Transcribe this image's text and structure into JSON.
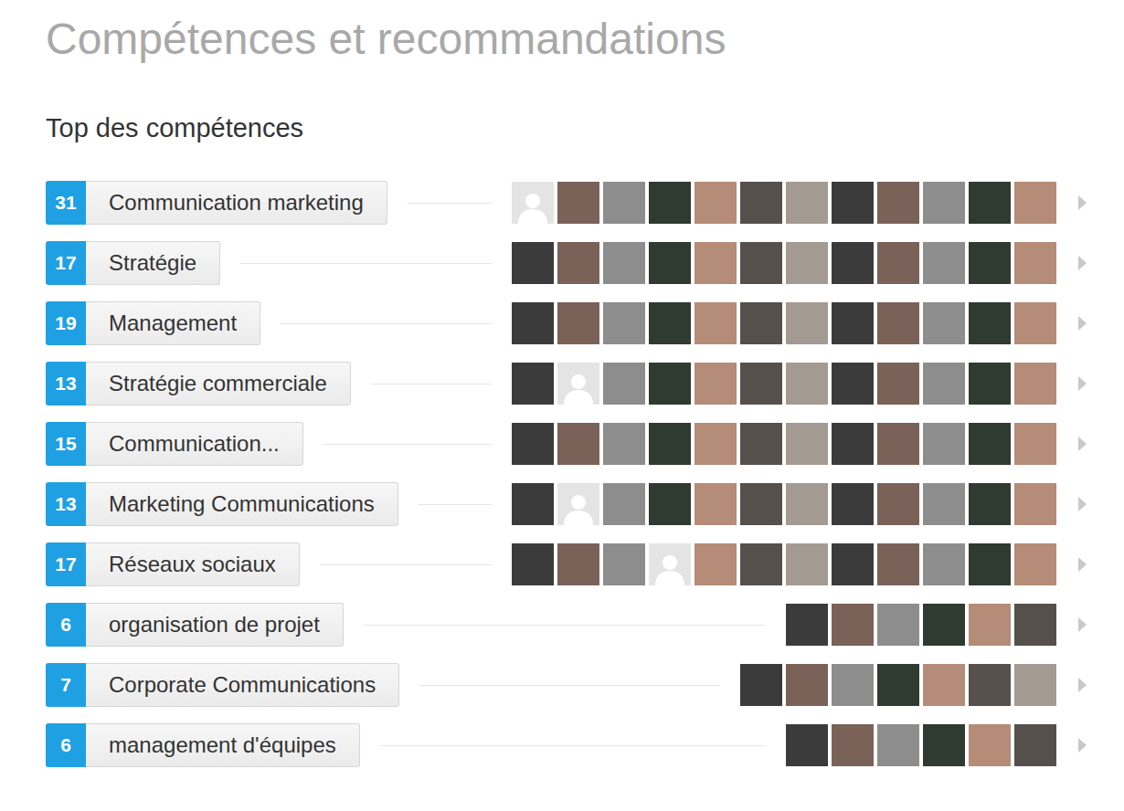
{
  "section": {
    "title": "Compétences et recommandations",
    "subtitle": "Top des compétences"
  },
  "skills": [
    {
      "count": "31",
      "name": "Communication marketing",
      "endorsers": [
        {
          "placeholder": true
        },
        {
          "placeholder": false
        },
        {
          "placeholder": false
        },
        {
          "placeholder": false
        },
        {
          "placeholder": false
        },
        {
          "placeholder": false
        },
        {
          "placeholder": false
        },
        {
          "placeholder": false
        },
        {
          "placeholder": false
        },
        {
          "placeholder": false
        },
        {
          "placeholder": false
        },
        {
          "placeholder": false
        }
      ]
    },
    {
      "count": "17",
      "name": "Stratégie",
      "endorsers": [
        {
          "placeholder": false
        },
        {
          "placeholder": false
        },
        {
          "placeholder": false
        },
        {
          "placeholder": false
        },
        {
          "placeholder": false
        },
        {
          "placeholder": false
        },
        {
          "placeholder": false
        },
        {
          "placeholder": false
        },
        {
          "placeholder": false
        },
        {
          "placeholder": false
        },
        {
          "placeholder": false
        },
        {
          "placeholder": false
        }
      ]
    },
    {
      "count": "19",
      "name": "Management",
      "endorsers": [
        {
          "placeholder": false
        },
        {
          "placeholder": false
        },
        {
          "placeholder": false
        },
        {
          "placeholder": false
        },
        {
          "placeholder": false
        },
        {
          "placeholder": false
        },
        {
          "placeholder": false
        },
        {
          "placeholder": false
        },
        {
          "placeholder": false
        },
        {
          "placeholder": false
        },
        {
          "placeholder": false
        },
        {
          "placeholder": false
        }
      ]
    },
    {
      "count": "13",
      "name": "Stratégie commerciale",
      "endorsers": [
        {
          "placeholder": false
        },
        {
          "placeholder": true
        },
        {
          "placeholder": false
        },
        {
          "placeholder": false
        },
        {
          "placeholder": false
        },
        {
          "placeholder": false
        },
        {
          "placeholder": false
        },
        {
          "placeholder": false
        },
        {
          "placeholder": false
        },
        {
          "placeholder": false
        },
        {
          "placeholder": false
        },
        {
          "placeholder": false
        }
      ]
    },
    {
      "count": "15",
      "name": "Communication...",
      "endorsers": [
        {
          "placeholder": false
        },
        {
          "placeholder": false
        },
        {
          "placeholder": false
        },
        {
          "placeholder": false
        },
        {
          "placeholder": false
        },
        {
          "placeholder": false
        },
        {
          "placeholder": false
        },
        {
          "placeholder": false
        },
        {
          "placeholder": false
        },
        {
          "placeholder": false
        },
        {
          "placeholder": false
        },
        {
          "placeholder": false
        }
      ]
    },
    {
      "count": "13",
      "name": "Marketing Communications",
      "endorsers": [
        {
          "placeholder": false
        },
        {
          "placeholder": true
        },
        {
          "placeholder": false
        },
        {
          "placeholder": false
        },
        {
          "placeholder": false
        },
        {
          "placeholder": false
        },
        {
          "placeholder": false
        },
        {
          "placeholder": false
        },
        {
          "placeholder": false
        },
        {
          "placeholder": false
        },
        {
          "placeholder": false
        },
        {
          "placeholder": false
        }
      ]
    },
    {
      "count": "17",
      "name": "Réseaux sociaux",
      "endorsers": [
        {
          "placeholder": false
        },
        {
          "placeholder": false
        },
        {
          "placeholder": false
        },
        {
          "placeholder": true
        },
        {
          "placeholder": false
        },
        {
          "placeholder": false
        },
        {
          "placeholder": false
        },
        {
          "placeholder": false
        },
        {
          "placeholder": false
        },
        {
          "placeholder": false
        },
        {
          "placeholder": false
        },
        {
          "placeholder": false
        }
      ]
    },
    {
      "count": "6",
      "name": "organisation de projet",
      "endorsers": [
        {
          "placeholder": false
        },
        {
          "placeholder": false
        },
        {
          "placeholder": false
        },
        {
          "placeholder": false
        },
        {
          "placeholder": false
        },
        {
          "placeholder": false
        }
      ]
    },
    {
      "count": "7",
      "name": "Corporate Communications",
      "endorsers": [
        {
          "placeholder": false
        },
        {
          "placeholder": false
        },
        {
          "placeholder": false
        },
        {
          "placeholder": false
        },
        {
          "placeholder": false
        },
        {
          "placeholder": false
        },
        {
          "placeholder": false
        }
      ]
    },
    {
      "count": "6",
      "name": "management d'équipes",
      "endorsers": [
        {
          "placeholder": false
        },
        {
          "placeholder": false
        },
        {
          "placeholder": false
        },
        {
          "placeholder": false
        },
        {
          "placeholder": false
        },
        {
          "placeholder": false
        }
      ]
    }
  ]
}
